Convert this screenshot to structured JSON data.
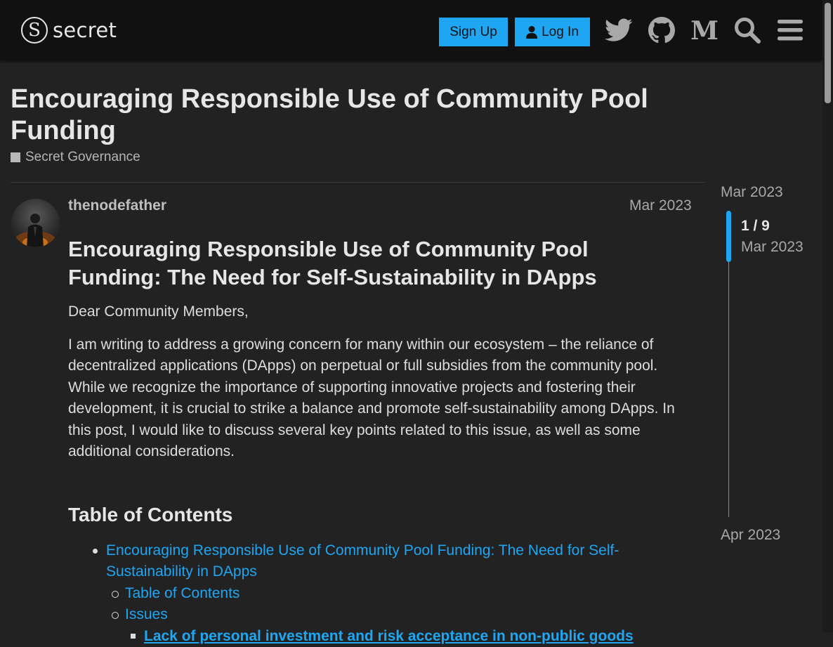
{
  "header": {
    "logo_text": "secret",
    "signup_label": "Sign Up",
    "login_label": "Log In",
    "icons": [
      "twitter-icon",
      "github-icon",
      "medium-icon",
      "search-icon",
      "menu-icon"
    ]
  },
  "topic": {
    "title": "Encouraging Responsible Use of Community Pool Funding",
    "category": "Secret Governance"
  },
  "post": {
    "username": "thenodefather",
    "date": "Mar 2023",
    "heading": "Encouraging Responsible Use of Community Pool Funding: The Need for Self-Sustainability in DApps",
    "greeting": "Dear Community Members,",
    "intro": "I am writing to address a growing concern for many within our ecosystem – the reliance of decentralized applications (DApps) on perpetual or full subsidies from the community pool. While we recognize the importance of supporting innovative projects and fostering their development, it is crucial to strike a balance and promote self-sustainability among DApps. In this post, I would like to discuss several key points related to this issue, as well as some additional considerations.",
    "toc_heading": "Table of Contents",
    "toc": [
      "Encouraging Responsible Use of Community Pool Funding: The Need for Self-Sustainability in DApps",
      "Table of Contents",
      "Issues",
      "Lack of personal investment and risk acceptance in non-public goods"
    ]
  },
  "timeline": {
    "start": "Mar 2023",
    "count": "1 / 9",
    "current_date": "Mar 2023",
    "end": "Apr 2023"
  },
  "colors": {
    "accent": "#1fa6f3",
    "background": "#222222",
    "header_bg": "#111111"
  }
}
